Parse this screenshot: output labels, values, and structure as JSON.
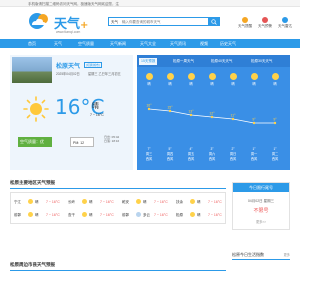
{
  "topbar": {
    "notice": "手机版请扫描二维码访问天气网，极速版天气网欢迎您，注"
  },
  "header": {
    "logo_text": "天气",
    "logo_plus": "+",
    "logo_url": "www.tianqi.com",
    "search_select": "天气",
    "search_placeholder": "输入你要查询的城市天气",
    "links": [
      "天气提醒",
      "天气预警",
      "天气雷达"
    ]
  },
  "nav": {
    "items": [
      "首页",
      "天气",
      "空气质量",
      "天气新闻",
      "天气大全",
      "天气资讯",
      "视频",
      "历史天气"
    ]
  },
  "current": {
    "city": "松原天气",
    "tag": "[切换城市]",
    "date": "2025年04月02日",
    "lunar": "星期三 乙巳年三月初五",
    "temp": "16°C",
    "desc": "晴",
    "range": "7 ~ 16°C",
    "aqi_label": "空气质量：优",
    "pm_label": "PM: 12",
    "sunrise": "日出: 05:42",
    "sunset": "日落: 18:16"
  },
  "forecast": {
    "tabs": [
      "15天预报",
      "松原一周天气",
      "松原40天天气",
      "松原30天天气"
    ],
    "days": [
      {
        "date": "周三",
        "wx": "晴"
      },
      {
        "date": "周四",
        "wx": "晴"
      },
      {
        "date": "周五",
        "wx": "晴"
      },
      {
        "date": "周六",
        "wx": "晴"
      },
      {
        "date": "周日",
        "wx": "晴"
      },
      {
        "date": "周一",
        "wx": "晴"
      },
      {
        "date": "周二",
        "wx": "晴"
      }
    ],
    "highs": [
      16,
      15,
      13,
      12,
      11,
      9,
      9
    ],
    "highs_label": [
      "16°",
      "15°",
      "13°",
      "12°",
      "11°",
      "9°",
      "9°"
    ],
    "lows": [
      "7°",
      "5°",
      "4°",
      "3°",
      "2°",
      "1°",
      "1°"
    ],
    "wind": [
      "西风",
      "西风",
      "西风",
      "西风",
      "西风",
      "西风",
      "西风"
    ]
  },
  "section1": {
    "title": "松原主要地区天气预报",
    "rows": [
      [
        {
          "name": "宁江",
          "wx": "晴",
          "temp": "7 ~ 16°C"
        },
        {
          "name": "长岭",
          "wx": "晴",
          "temp": "7 ~ 16°C"
        },
        {
          "name": "乾安",
          "wx": "晴",
          "temp": "7 ~ 16°C"
        },
        {
          "name": "扶余",
          "wx": "晴",
          "temp": "7 ~ 16°C"
        }
      ],
      [
        {
          "name": "前郭",
          "wx": "晴",
          "temp": "7 ~ 16°C"
        },
        {
          "name": "查干",
          "wx": "晴",
          "temp": "7 ~ 16°C"
        },
        {
          "name": "前郭",
          "wx": "多云",
          "temp": "7 ~ 16°C"
        },
        {
          "name": "松原",
          "wx": "晴",
          "temp": "7 ~ 16°C"
        }
      ]
    ]
  },
  "section2": {
    "title": "松原周边市县天气预报"
  },
  "side1": {
    "head": "今日限行尾号",
    "date": "04月02日 星期三",
    "status": "不限号",
    "more": "更多>>"
  },
  "side2": {
    "title": "松原今日生活指数",
    "more": "更多"
  },
  "colors": {
    "brand": "#2c9ae8",
    "aqi": "#60b040",
    "warn": "#e55555"
  }
}
